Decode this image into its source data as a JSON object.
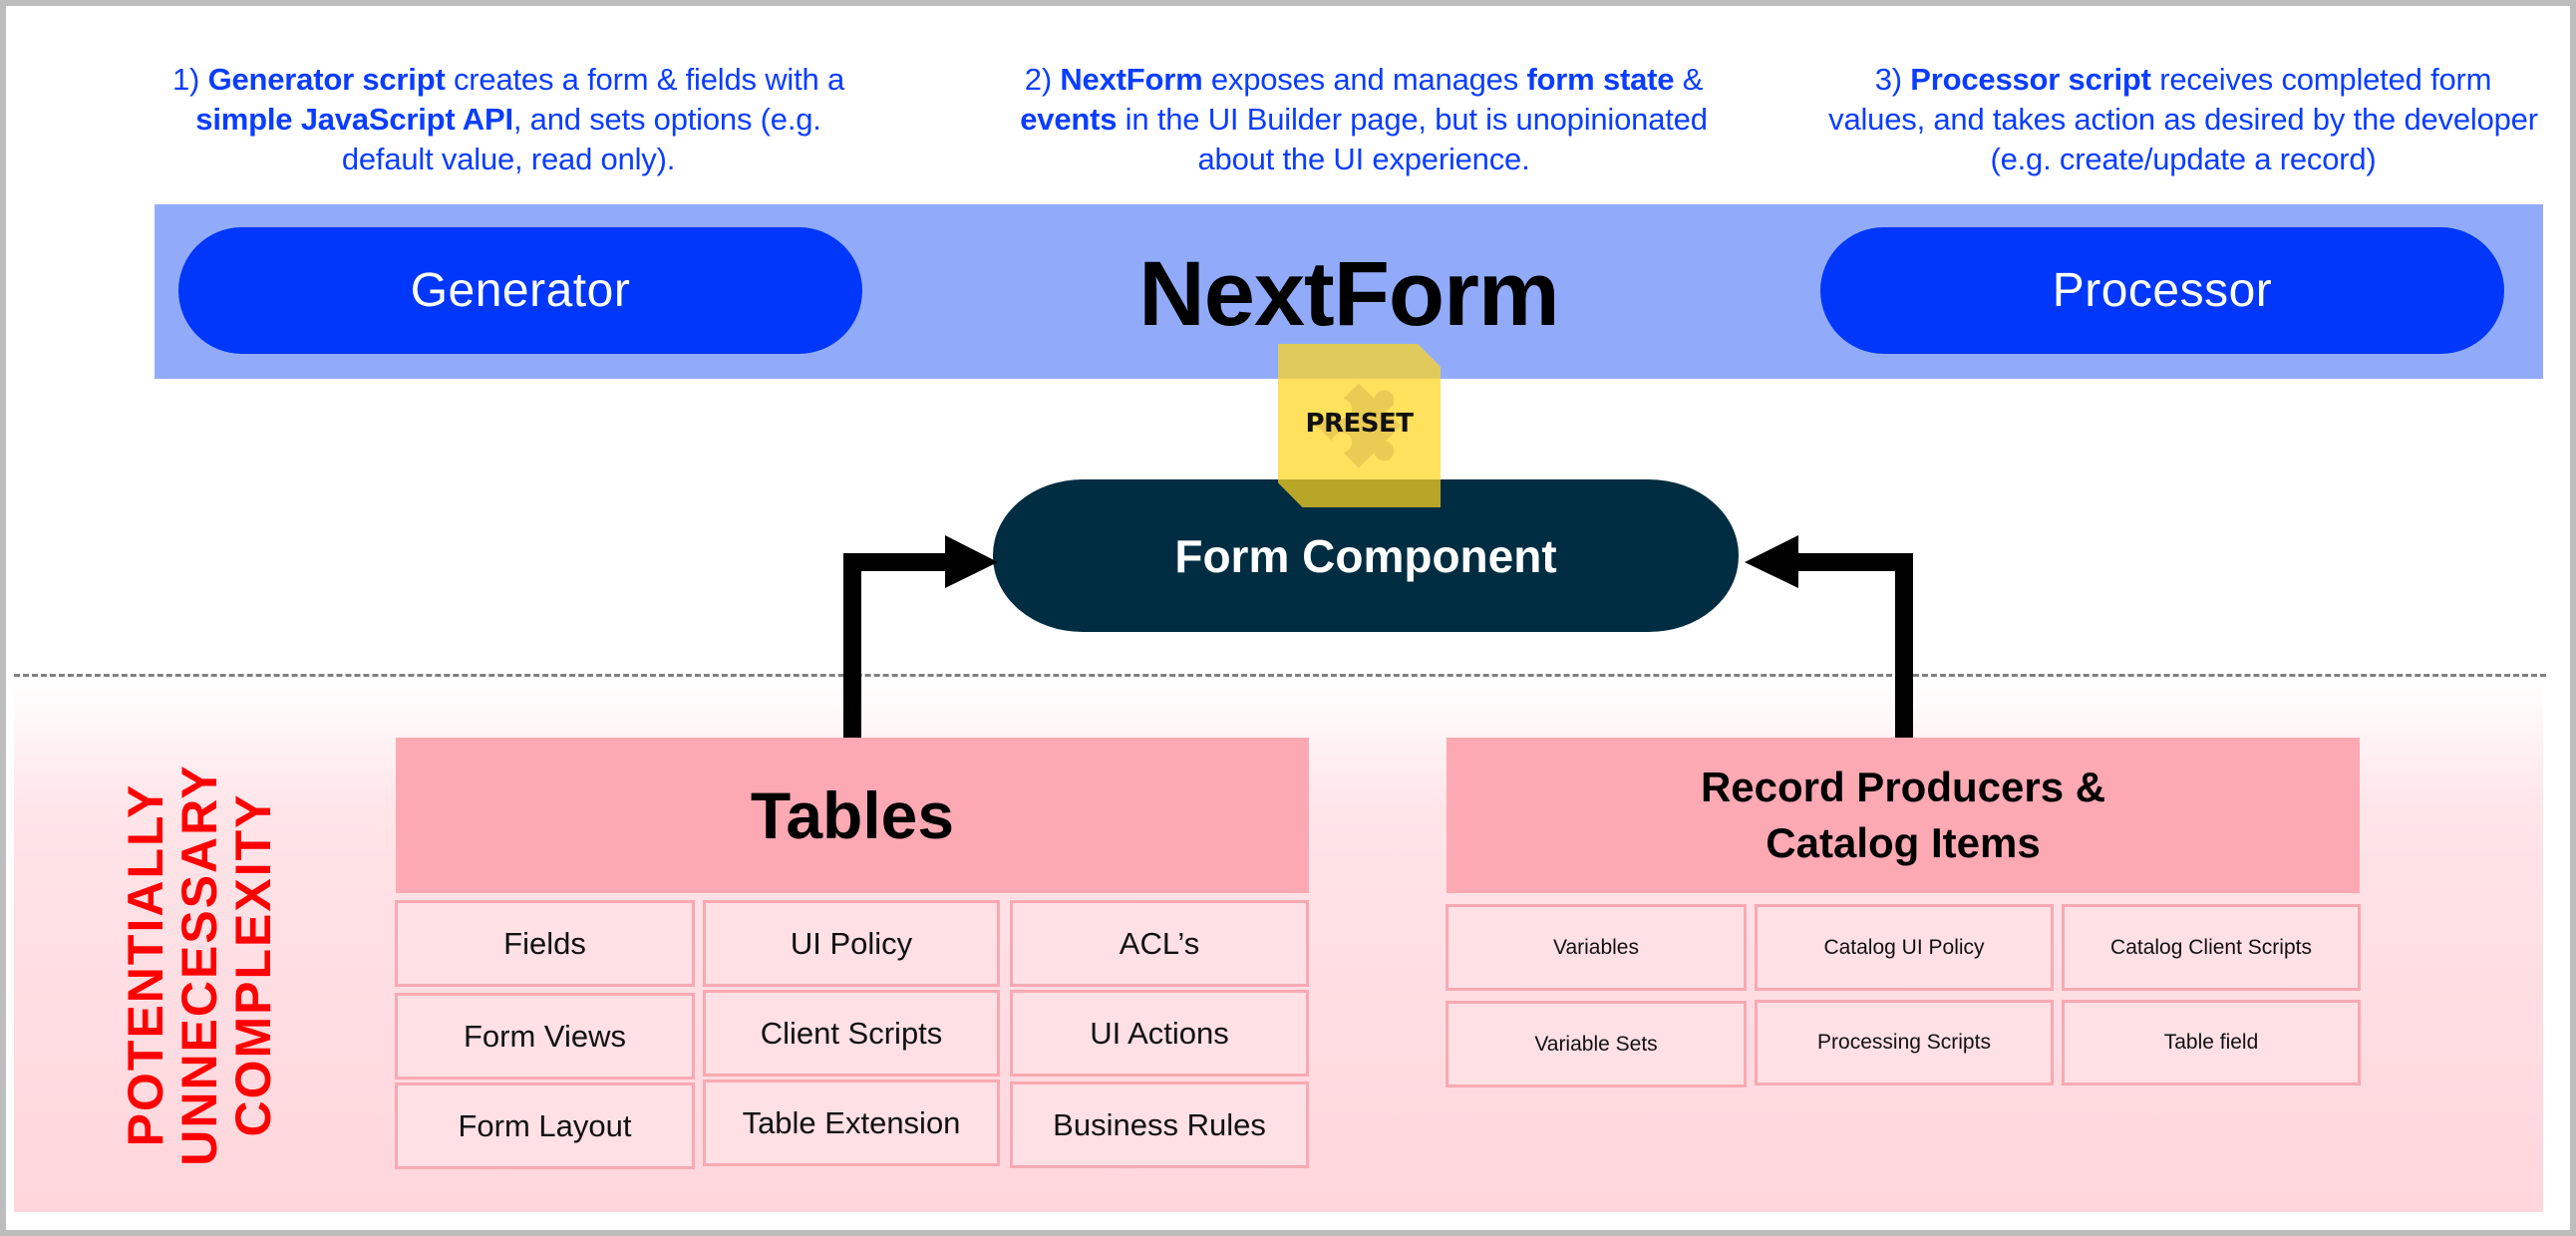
{
  "descriptions": [
    {
      "number": "1)",
      "parts": [
        {
          "text": "Generator script",
          "bold": true
        },
        {
          "text": " creates a form & fields with a ",
          "bold": false
        },
        {
          "text": "simple JavaScript API",
          "bold": true
        },
        {
          "text": ", and sets options (e.g. default value, read only).",
          "bold": false
        }
      ]
    },
    {
      "number": "2)",
      "parts": [
        {
          "text": "NextForm",
          "bold": true
        },
        {
          "text": " exposes and manages ",
          "bold": false
        },
        {
          "text": "form state",
          "bold": true
        },
        {
          "text": " & ",
          "bold": false
        },
        {
          "text": "events",
          "bold": true
        },
        {
          "text": " in the UI Builder page, but is unopinionated about the UI experience.",
          "bold": false
        }
      ]
    },
    {
      "number": "3)",
      "parts": [
        {
          "text": "Processor script",
          "bold": true
        },
        {
          "text": " receives completed form values, and takes action as desired by the developer (e.g. create/update a record)",
          "bold": false
        }
      ]
    }
  ],
  "banner": {
    "title": "NextForm",
    "generator_label": "Generator",
    "processor_label": "Processor"
  },
  "preset": {
    "label": "PRESET",
    "icon": "puzzle-piece-icon"
  },
  "form_component": {
    "label": "Form Component"
  },
  "complexity_zone": {
    "label_lines": [
      "POTENTIALLY",
      "UNNECESSARY",
      "COMPLEXITY"
    ]
  },
  "tables_group": {
    "title": "Tables",
    "items": [
      [
        "Fields",
        "UI Policy",
        "ACL’s"
      ],
      [
        "Form Views",
        "Client Scripts",
        "UI Actions"
      ],
      [
        "Form Layout",
        "Table Extension",
        "Business Rules"
      ]
    ]
  },
  "record_group": {
    "title_lines": [
      "Record Producers &",
      "Catalog Items"
    ],
    "items": [
      [
        "Variables",
        "Catalog UI Policy",
        "Catalog Client Scripts"
      ],
      [
        "Variable Sets",
        "Processing Scripts",
        "Table field"
      ]
    ]
  },
  "colors": {
    "description_text": "#0a3dff",
    "banner_bg": "#91abfa",
    "pill_bg": "#0037fa",
    "form_component_bg": "#002d41",
    "preset_bg": "#ffd61e",
    "complexity_label": "#ff0000",
    "group_header_bg": "#fda9b3",
    "cell_bg": "#fee0e5",
    "cell_border": "#f8a9b3"
  }
}
